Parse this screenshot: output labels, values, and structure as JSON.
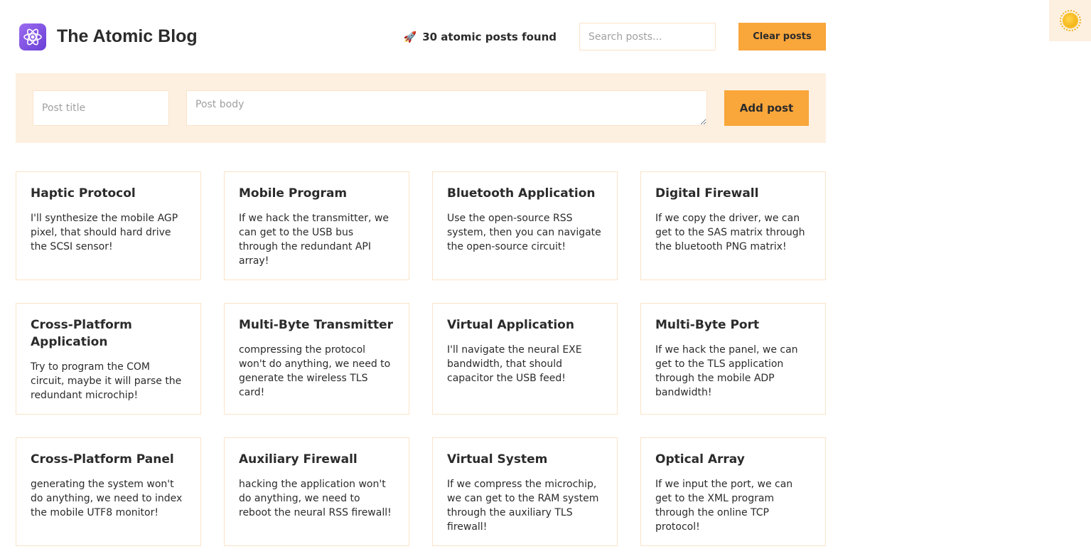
{
  "header": {
    "title": "The Atomic Blog",
    "logo_icon": "atom-icon",
    "count_icon": "rocket-icon",
    "post_count_text": "30 atomic posts found",
    "search_placeholder": "Search posts...",
    "clear_label": "Clear posts"
  },
  "theme_toggle": {
    "icon": "sun-icon"
  },
  "form": {
    "title_placeholder": "Post title",
    "body_placeholder": "Post body",
    "add_label": "Add post"
  },
  "posts": [
    {
      "title": "Haptic Protocol",
      "body": "I'll synthesize the mobile AGP pixel, that should hard drive the SCSI sensor!"
    },
    {
      "title": "Mobile Program",
      "body": "If we hack the transmitter, we can get to the USB bus through the redundant API array!"
    },
    {
      "title": "Bluetooth Application",
      "body": "Use the open-source RSS system, then you can navigate the open-source circuit!"
    },
    {
      "title": "Digital Firewall",
      "body": "If we copy the driver, we can get to the SAS matrix through the bluetooth PNG matrix!"
    },
    {
      "title": "Cross-Platform Application",
      "body": "Try to program the COM circuit, maybe it will parse the redundant microchip!"
    },
    {
      "title": "Multi-Byte Transmitter",
      "body": "compressing the protocol won't do anything, we need to generate the wireless TLS card!"
    },
    {
      "title": "Virtual Application",
      "body": "I'll navigate the neural EXE bandwidth, that should capacitor the USB feed!"
    },
    {
      "title": "Multi-Byte Port",
      "body": "If we hack the panel, we can get to the TLS application through the mobile ADP bandwidth!"
    },
    {
      "title": "Cross-Platform Panel",
      "body": "generating the system won't do anything, we need to index the mobile UTF8 monitor!"
    },
    {
      "title": "Auxiliary Firewall",
      "body": "hacking the application won't do anything, we need to reboot the neural RSS firewall!"
    },
    {
      "title": "Virtual System",
      "body": "If we compress the microchip, we can get to the RAM system through the auxiliary TLS firewall!"
    },
    {
      "title": "Optical Array",
      "body": "If we input the port, we can get to the XML program through the online TCP protocol!"
    }
  ]
}
